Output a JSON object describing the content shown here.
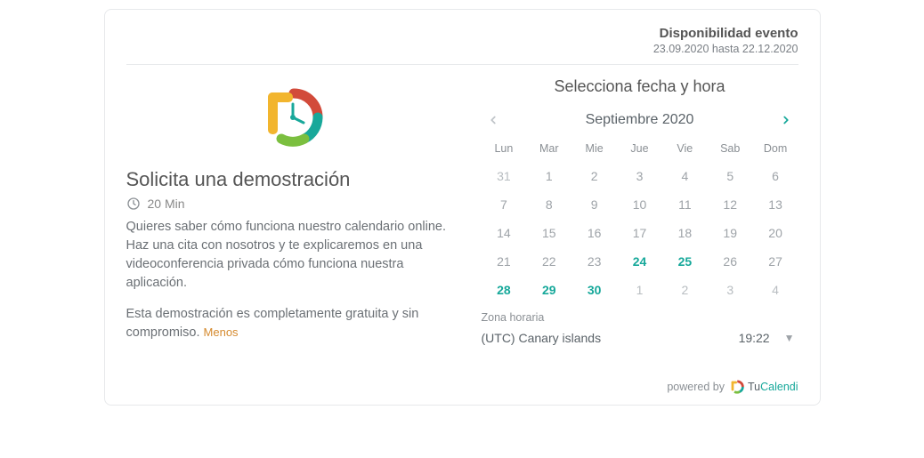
{
  "availability": {
    "title": "Disponibilidad evento",
    "range": "23.09.2020 hasta 22.12.2020"
  },
  "event": {
    "title": "Solicita una demostración",
    "duration": "20 Min",
    "description_p1": "Quieres saber cómo funciona nuestro calendario online. Haz una cita con nosotros y te explicaremos en una videoconferencia privada cómo funciona nuestra aplicación.",
    "description_p2": "Esta demostración es completamente gratuita y sin compromiso.",
    "less_label": "Menos"
  },
  "picker": {
    "title": "Selecciona fecha y hora",
    "month_label": "Septiembre 2020",
    "weekdays": [
      "Lun",
      "Mar",
      "Mie",
      "Jue",
      "Vie",
      "Sab",
      "Dom"
    ],
    "weeks": [
      [
        {
          "n": "31",
          "state": "out"
        },
        {
          "n": "1",
          "state": "dis"
        },
        {
          "n": "2",
          "state": "dis"
        },
        {
          "n": "3",
          "state": "dis"
        },
        {
          "n": "4",
          "state": "dis"
        },
        {
          "n": "5",
          "state": "dis"
        },
        {
          "n": "6",
          "state": "dis"
        }
      ],
      [
        {
          "n": "7",
          "state": "dis"
        },
        {
          "n": "8",
          "state": "dis"
        },
        {
          "n": "9",
          "state": "dis"
        },
        {
          "n": "10",
          "state": "dis"
        },
        {
          "n": "11",
          "state": "dis"
        },
        {
          "n": "12",
          "state": "dis"
        },
        {
          "n": "13",
          "state": "dis"
        }
      ],
      [
        {
          "n": "14",
          "state": "dis"
        },
        {
          "n": "15",
          "state": "dis"
        },
        {
          "n": "16",
          "state": "dis"
        },
        {
          "n": "17",
          "state": "dis"
        },
        {
          "n": "18",
          "state": "dis"
        },
        {
          "n": "19",
          "state": "dis"
        },
        {
          "n": "20",
          "state": "dis"
        }
      ],
      [
        {
          "n": "21",
          "state": "dis"
        },
        {
          "n": "22",
          "state": "dis"
        },
        {
          "n": "23",
          "state": "dis"
        },
        {
          "n": "24",
          "state": "avail"
        },
        {
          "n": "25",
          "state": "avail"
        },
        {
          "n": "26",
          "state": "dis"
        },
        {
          "n": "27",
          "state": "dis"
        }
      ],
      [
        {
          "n": "28",
          "state": "avail"
        },
        {
          "n": "29",
          "state": "avail"
        },
        {
          "n": "30",
          "state": "avail"
        },
        {
          "n": "1",
          "state": "out"
        },
        {
          "n": "2",
          "state": "out"
        },
        {
          "n": "3",
          "state": "out"
        },
        {
          "n": "4",
          "state": "out"
        }
      ]
    ]
  },
  "timezone": {
    "label": "Zona horaria",
    "name": "(UTC) Canary islands",
    "time": "19:22"
  },
  "footer": {
    "powered_by": "powered by",
    "brand_tu": "Tu",
    "brand_cal": "Calendi"
  }
}
